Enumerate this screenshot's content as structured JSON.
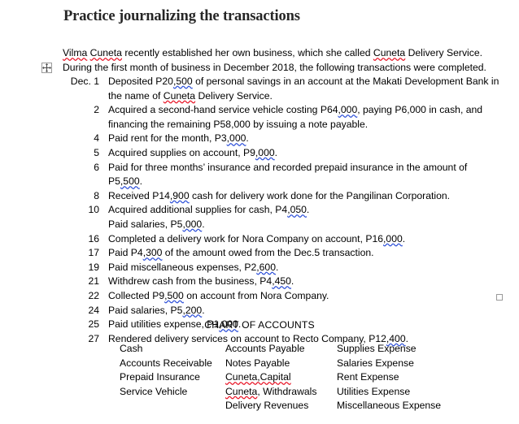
{
  "document": {
    "title": "Practice journalizing the transactions",
    "intro": {
      "segment_1": "Vilma",
      "segment_2": "Cuneta",
      "segment_3": " recently established her own business, which she called ",
      "segment_4": "Cuneta",
      "segment_5": " Delivery Service. During the first month of business in December 2018, the following transactions were completed."
    }
  },
  "handles": {
    "move_handle_icon": "table-move-handle-icon",
    "resize_handle_icon": "table-resize-handle-icon"
  },
  "transactions": [
    {
      "date": "Dec. 1",
      "parts": [
        {
          "text": "Deposited P20",
          "mark": "none"
        },
        {
          "text": ",500",
          "mark": "blue"
        },
        {
          "text": " of personal savings in an account at the Makati Development Bank in the name of ",
          "mark": "none"
        },
        {
          "text": "Cuneta",
          "mark": "red"
        },
        {
          "text": " Delivery Service.",
          "mark": "none"
        }
      ]
    },
    {
      "date": "2",
      "parts": [
        {
          "text": "Acquired a second-hand service vehicle costing P64",
          "mark": "none"
        },
        {
          "text": ",000",
          "mark": "blue"
        },
        {
          "text": ", paying P6,000 in cash, and financing the remaining P58,000 by issuing a note payable.",
          "mark": "none"
        }
      ]
    },
    {
      "date": "4",
      "parts": [
        {
          "text": "Paid rent for the month, P3",
          "mark": "none"
        },
        {
          "text": ",000",
          "mark": "blue"
        },
        {
          "text": ".",
          "mark": "none"
        }
      ]
    },
    {
      "date": "5",
      "parts": [
        {
          "text": "Acquired supplies on account, P9",
          "mark": "none"
        },
        {
          "text": ",000",
          "mark": "blue"
        },
        {
          "text": ".",
          "mark": "none"
        }
      ]
    },
    {
      "date": "6",
      "parts": [
        {
          "text": "Paid for three months’ insurance and recorded prepaid insurance in the amount of P5",
          "mark": "none"
        },
        {
          "text": ",500",
          "mark": "blue"
        },
        {
          "text": ".",
          "mark": "none"
        }
      ]
    },
    {
      "date": "8",
      "parts": [
        {
          "text": "Received P14",
          "mark": "none"
        },
        {
          "text": ",900",
          "mark": "blue"
        },
        {
          "text": " cash for delivery work done for the Pangilinan Corporation.",
          "mark": "none"
        }
      ]
    },
    {
      "date": "10",
      "parts": [
        {
          "text": "Acquired additional supplies for cash, P4",
          "mark": "none"
        },
        {
          "text": ",050",
          "mark": "blue"
        },
        {
          "text": ".",
          "mark": "none"
        }
      ]
    },
    {
      "date": "",
      "parts": [
        {
          "text": "Paid salaries, P5",
          "mark": "none"
        },
        {
          "text": ",000",
          "mark": "blue"
        },
        {
          "text": ".",
          "mark": "none"
        }
      ]
    },
    {
      "date": "16",
      "parts": [
        {
          "text": "Completed a delivery work for Nora Company on account, P16",
          "mark": "none"
        },
        {
          "text": ",000",
          "mark": "blue"
        },
        {
          "text": ".",
          "mark": "none"
        }
      ]
    },
    {
      "date": "17",
      "parts": [
        {
          "text": "Paid P4",
          "mark": "none"
        },
        {
          "text": ",300",
          "mark": "blue"
        },
        {
          "text": " of the amount owed from the Dec.5 transaction.",
          "mark": "none"
        }
      ]
    },
    {
      "date": "19",
      "parts": [
        {
          "text": "Paid miscellaneous expenses, P2",
          "mark": "none"
        },
        {
          "text": ",600",
          "mark": "blue"
        },
        {
          "text": ".",
          "mark": "none"
        }
      ]
    },
    {
      "date": "21",
      "parts": [
        {
          "text": "Withdrew cash from the business, P4",
          "mark": "none"
        },
        {
          "text": ",450",
          "mark": "blue"
        },
        {
          "text": ".",
          "mark": "none"
        }
      ]
    },
    {
      "date": "22",
      "parts": [
        {
          "text": "Collected P9",
          "mark": "none"
        },
        {
          "text": ",500",
          "mark": "blue"
        },
        {
          "text": " on account from Nora Company.",
          "mark": "none"
        }
      ]
    },
    {
      "date": "24",
      "parts": [
        {
          "text": "Paid salaries, P5",
          "mark": "none"
        },
        {
          "text": ",200",
          "mark": "blue"
        },
        {
          "text": ".",
          "mark": "none"
        }
      ]
    },
    {
      "date": "25",
      "parts": [
        {
          "text": "Paid utilities expense, P1",
          "mark": "none"
        },
        {
          "text": ",000",
          "mark": "blue"
        },
        {
          "text": ".",
          "mark": "none"
        }
      ]
    },
    {
      "date": "27",
      "parts": [
        {
          "text": "Rendered delivery services on account to Recto Company, P12",
          "mark": "none"
        },
        {
          "text": ",400",
          "mark": "blue"
        },
        {
          "text": ".",
          "mark": "none"
        }
      ]
    }
  ],
  "chart_of_accounts": {
    "heading": "CHART OF ACCOUNTS",
    "columns": [
      {
        "items": [
          {
            "parts": [
              {
                "text": "Cash",
                "mark": "none"
              }
            ]
          },
          {
            "parts": [
              {
                "text": "Accounts Receivable",
                "mark": "none"
              }
            ]
          },
          {
            "parts": [
              {
                "text": "Prepaid Insurance",
                "mark": "none"
              }
            ]
          },
          {
            "parts": [
              {
                "text": "Service Vehicle",
                "mark": "none"
              }
            ]
          }
        ]
      },
      {
        "items": [
          {
            "parts": [
              {
                "text": "Accounts Payable",
                "mark": "none"
              }
            ]
          },
          {
            "parts": [
              {
                "text": "Notes Payable",
                "mark": "none"
              }
            ]
          },
          {
            "parts": [
              {
                "text": "Cuneta,Capital",
                "mark": "red"
              }
            ]
          },
          {
            "parts": [
              {
                "text": "Cuneta",
                "mark": "red"
              },
              {
                "text": ", Withdrawals",
                "mark": "none"
              }
            ]
          },
          {
            "parts": [
              {
                "text": "Delivery Revenues",
                "mark": "none"
              }
            ]
          }
        ]
      },
      {
        "items": [
          {
            "parts": [
              {
                "text": "Supplies Expense",
                "mark": "none"
              }
            ]
          },
          {
            "parts": [
              {
                "text": "Salaries Expense",
                "mark": "none"
              }
            ]
          },
          {
            "parts": [
              {
                "text": "Rent Expense",
                "mark": "none"
              }
            ]
          },
          {
            "parts": [
              {
                "text": "Utilities Expense",
                "mark": "none"
              }
            ]
          },
          {
            "parts": [
              {
                "text": "Miscellaneous Expense",
                "mark": "none"
              }
            ]
          }
        ]
      }
    ]
  },
  "colors": {
    "spelling_error": "#e81123",
    "grammar_error": "#2b4ed8",
    "title": "#262626",
    "body_text": "#000000",
    "handle_border": "#9a9a9a",
    "page_background": "#ffffff"
  }
}
